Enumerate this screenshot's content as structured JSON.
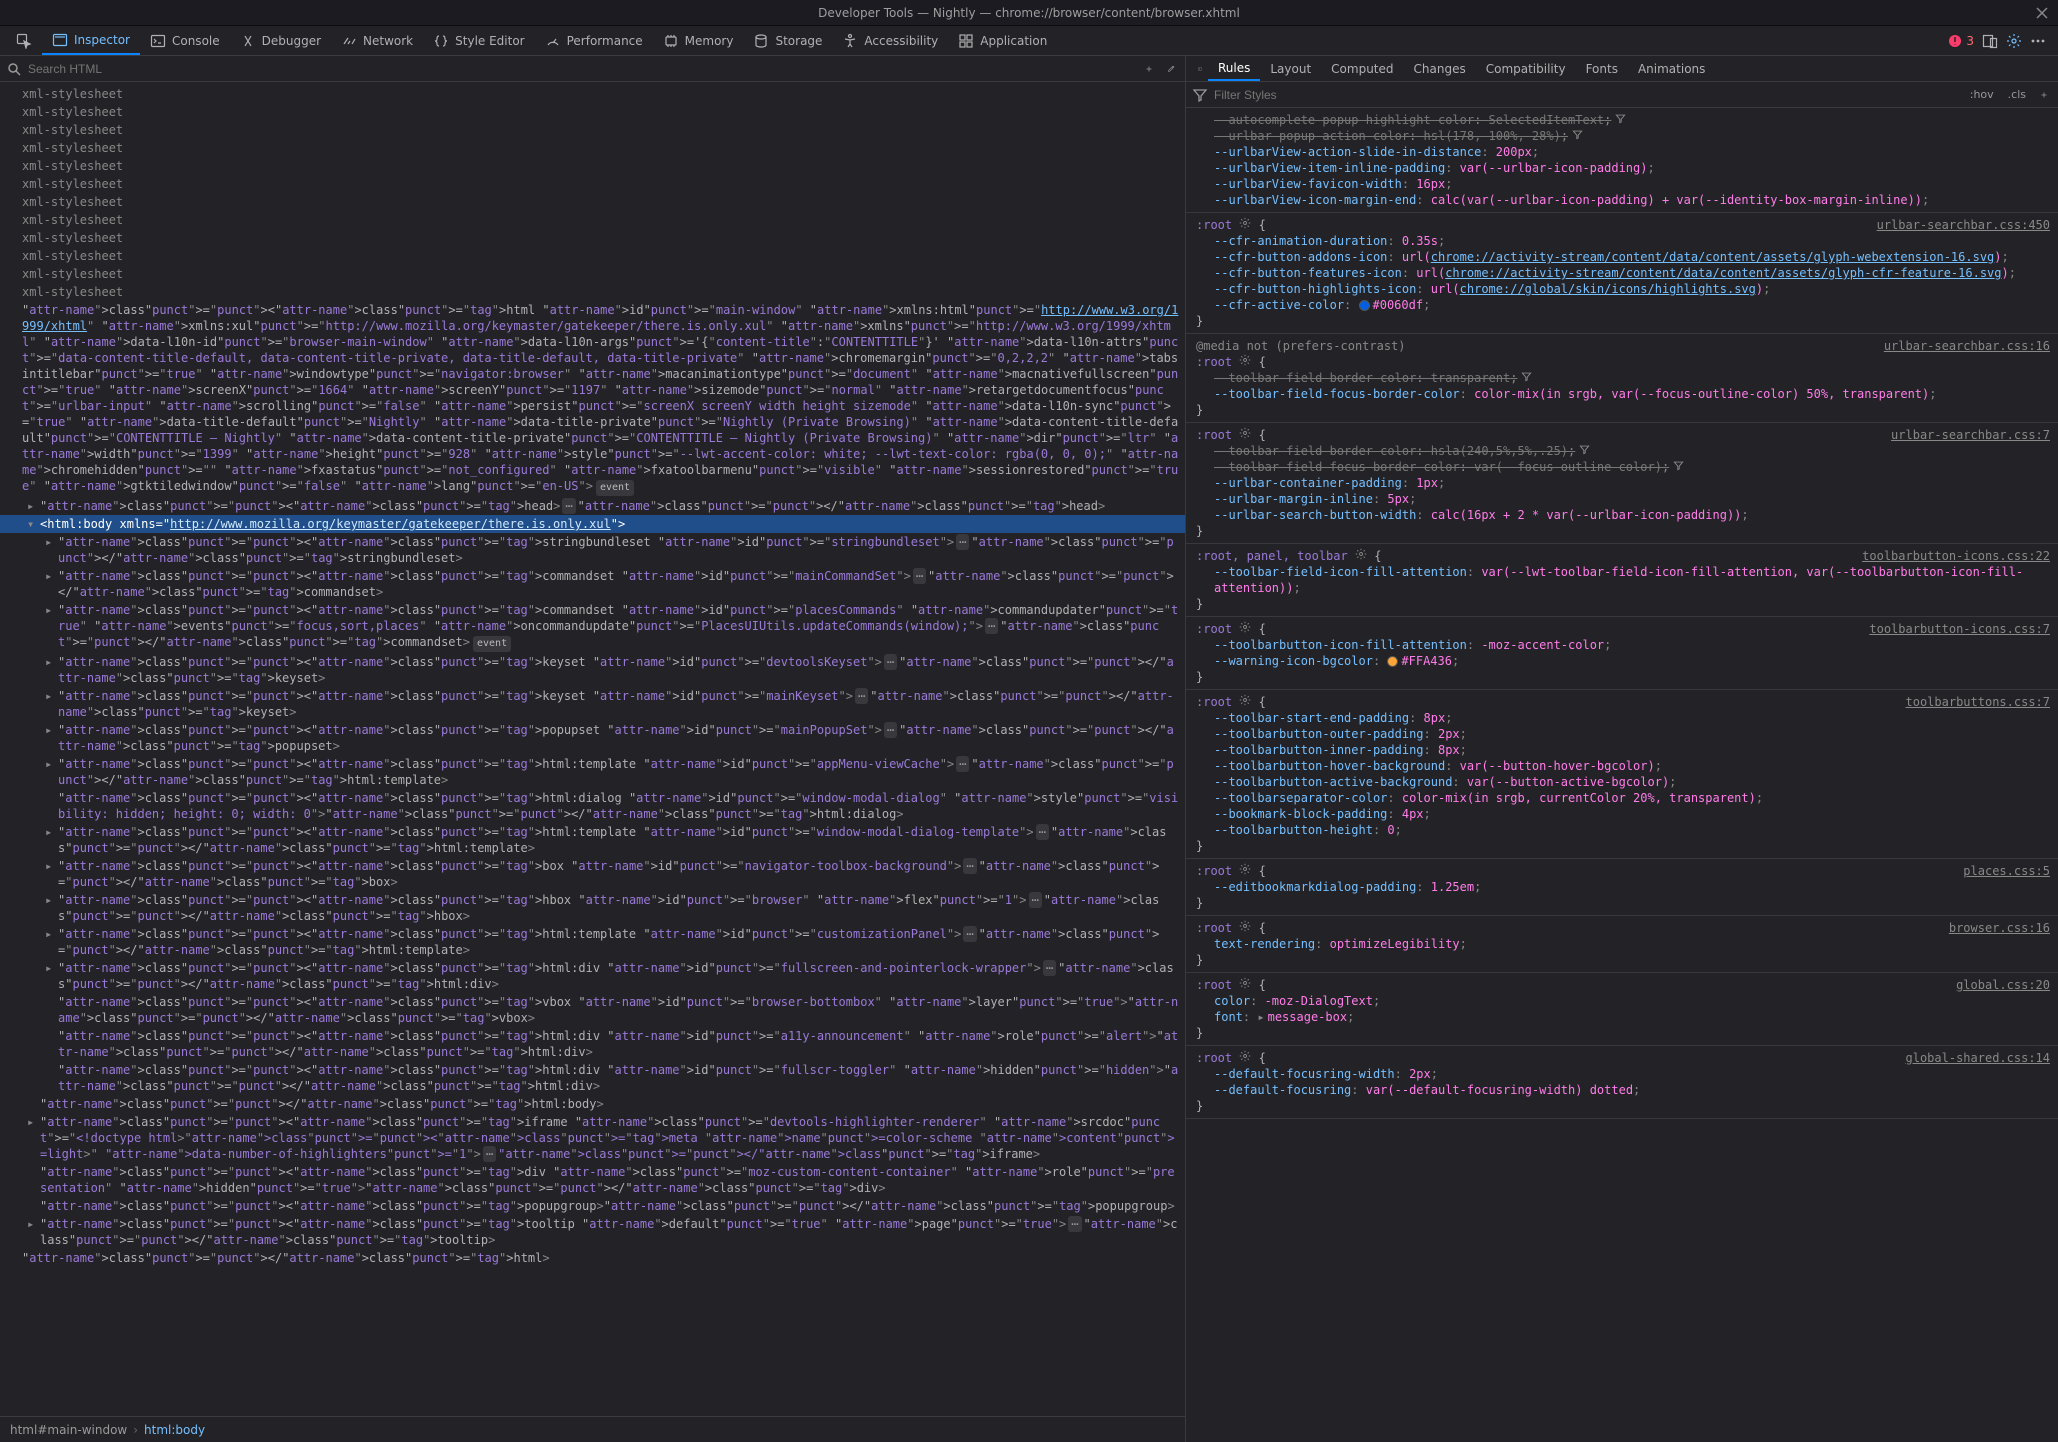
{
  "window": {
    "title": "Developer Tools — Nightly — chrome://browser/content/browser.xhtml"
  },
  "toolbar": {
    "inspector": "Inspector",
    "console": "Console",
    "debugger": "Debugger",
    "network": "Network",
    "styleeditor": "Style Editor",
    "performance": "Performance",
    "memory": "Memory",
    "storage": "Storage",
    "accessibility": "Accessibility",
    "application": "Application",
    "error_count": "3"
  },
  "searchbar": {
    "placeholder": "Search HTML"
  },
  "markup": {
    "xml_stylesheet": "xml-stylesheet",
    "html_open": "<html id=\"main-window\" xmlns:html=\"http://www.w3.org/1999/xhtml\" xmlns:xul=\"http://www.mozilla.org/keymaster/gatekeeper/there.is.only.xul\" xmlns=\"http://www.w3.org/1999/xhtml\" data-l10n-id=\"browser-main-window\" data-l10n-args='{\"content-title\":\"CONTENTTITLE\"}' data-l10n-attrs=\"data-content-title-default, data-content-title-private, data-title-default, data-title-private\" chromemargin=\"0,2,2,2\" tabsintitlebar=\"true\" windowtype=\"navigator:browser\" macanimationtype=\"document\" macnativefullscreen=\"true\" screenX=\"1664\" screenY=\"1197\" sizemode=\"normal\" retargetdocumentfocus=\"urlbar-input\" scrolling=\"false\" persist=\"screenX screenY width height sizemode\" data-l10n-sync=\"true\" data-title-default=\"Nightly\" data-title-private=\"Nightly (Private Browsing)\" data-content-title-default=\"CONTENTTITLE — Nightly\" data-content-title-private=\"CONTENTTITLE — Nightly (Private Browsing)\" dir=\"ltr\" width=\"1399\" height=\"928\" style=\"--lwt-accent-color: white; --lwt-text-color: rgba(0, 0, 0);\" chromehidden=\"\" fxastatus=\"not_configured\" fxatoolbarmenu=\"visible\" sessionrestored=\"true\" gtktiledwindow=\"false\" lang=\"en-US\">",
    "head": "<head>…</head>",
    "body_open": "<html:body xmlns=\"http://www.mozilla.org/keymaster/gatekeeper/there.is.only.xul\">",
    "child_stringbundleset": "<stringbundleset id=\"stringbundleset\">…</stringbundleset>",
    "child_commandset1": "<commandset id=\"mainCommandSet\">…</commandset>",
    "child_commandset2": "<commandset id=\"placesCommands\" commandupdater=\"true\" events=\"focus,sort,places\" oncommandupdate=\"PlacesUIUtils.updateCommands(window);\">…</commandset>",
    "child_keyset1": "<keyset id=\"devtoolsKeyset\">…</keyset>",
    "child_keyset2": "<keyset id=\"mainKeyset\">…</keyset>",
    "child_popupset": "<popupset id=\"mainPopupSet\">…</popupset>",
    "child_template1": "<html:template id=\"appMenu-viewCache\">…</html:template>",
    "child_dialog": "<html:dialog id=\"window-modal-dialog\" style=\"visibility: hidden; height: 0; width: 0\"></html:dialog>",
    "child_template2": "<html:template id=\"window-modal-dialog-template\">…</html:template>",
    "child_box": "<box id=\"navigator-toolbox-background\">…</box>",
    "child_hbox": "<hbox id=\"browser\" flex=\"1\">…</hbox>",
    "child_template3": "<html:template id=\"customizationPanel\">…</html:template>",
    "child_div1": "<html:div id=\"fullscreen-and-pointerlock-wrapper\">…</html:div>",
    "child_vbox": "<vbox id=\"browser-bottombox\" layer=\"true\"></vbox>",
    "child_div2": "<html:div id=\"a11y-announcement\" role=\"alert\"></html:div>",
    "child_div3": "<html:div id=\"fullscr-toggler\" hidden=\"hidden\"></html:div>",
    "body_close": "</html:body>",
    "iframe": "<iframe class=\"devtools-highlighter-renderer\" srcdoc=\"<!doctype html><meta name=color-scheme content=light>\" data-number-of-highlighters=\"1\">…</iframe>",
    "div_moz": "<div class=\"moz-custom-content-container\" role=\"presentation\" hidden=\"true\"></div>",
    "popupgroup": "<popupgroup></popupgroup>",
    "tooltip": "<tooltip default=\"true\" page=\"true\">…</tooltip>",
    "html_close": "</html>",
    "event_label": "event"
  },
  "breadcrumbs": {
    "c1": "html#main-window",
    "c2": "html:body"
  },
  "rules_tabs": {
    "rules": "Rules",
    "layout": "Layout",
    "computed": "Computed",
    "changes": "Changes",
    "compatibility": "Compatibility",
    "fonts": "Fonts",
    "animations": "Animations"
  },
  "filterbar": {
    "placeholder": "Filter Styles",
    "hov": ":hov",
    "cls": ".cls"
  },
  "rules": [
    {
      "source": "",
      "selector": "",
      "decls": [
        {
          "overridden": true,
          "prop": "--autocomplete-popup-highlight-color",
          "val": "SelectedItemText",
          "filter": true
        },
        {
          "overridden": true,
          "prop": "--urlbar-popup-action-color",
          "val": "hsl(178, 100%, 28%)",
          "filter": true
        },
        {
          "prop": "--urlbarView-action-slide-in-distance",
          "val": "200px"
        },
        {
          "prop": "--urlbarView-item-inline-padding",
          "val": "var(--urlbar-icon-padding)"
        },
        {
          "prop": "--urlbarView-favicon-width",
          "val": "16px"
        },
        {
          "prop": "--urlbarView-icon-margin-end",
          "val": "calc(var(--urlbar-icon-padding) + var(--identity-box-margin-inline))"
        }
      ]
    },
    {
      "source": "urlbar-searchbar.css:450",
      "selector": ":root",
      "decls": [
        {
          "prop": "--cfr-animation-duration",
          "val": "0.35s"
        },
        {
          "prop": "--cfr-button-addons-icon",
          "val_pre": "url(",
          "link": "chrome://activity-stream/content/data/content/assets/glyph-webextension-16.svg",
          "val_post": ")"
        },
        {
          "prop": "--cfr-button-features-icon",
          "val_pre": "url(",
          "link": "chrome://activity-stream/content/data/content/assets/glyph-cfr-feature-16.svg",
          "val_post": ")"
        },
        {
          "prop": "--cfr-button-highlights-icon",
          "val_pre": "url(",
          "link": "chrome://global/skin/icons/highlights.svg",
          "val_post": ")"
        },
        {
          "prop": "--cfr-active-color",
          "swatch": "#0060df",
          "val": "#0060df"
        }
      ]
    },
    {
      "source": "urlbar-searchbar.css:16",
      "media": "@media not (prefers-contrast)",
      "selector": ":root",
      "decls": [
        {
          "overridden": true,
          "prop": "--toolbar-field-border-color",
          "val": "transparent",
          "filter": true
        },
        {
          "prop": "--toolbar-field-focus-border-color",
          "val": "color-mix(in srgb, var(--focus-outline-color) 50%, transparent)"
        }
      ]
    },
    {
      "source": "urlbar-searchbar.css:7",
      "selector": ":root",
      "decls": [
        {
          "overridden": true,
          "prop": "--toolbar-field-border-color",
          "val": "hsla(240,5%,5%,.25)",
          "filter": true
        },
        {
          "overridden": true,
          "prop": "--toolbar-field-focus-border-color",
          "val": "var(--focus-outline-color)",
          "filter": true
        },
        {
          "prop": "--urlbar-container-padding",
          "val": "1px"
        },
        {
          "prop": "--urlbar-margin-inline",
          "val": "5px"
        },
        {
          "prop": "--urlbar-search-button-width",
          "val": "calc(16px + 2 * var(--urlbar-icon-padding))"
        }
      ]
    },
    {
      "source": "toolbarbutton-icons.css:22",
      "selector": ":root, panel, toolbar",
      "decls": [
        {
          "prop": "--toolbar-field-icon-fill-attention",
          "val": "var(--lwt-toolbar-field-icon-fill-attention, var(--toolbarbutton-icon-fill-attention))"
        }
      ]
    },
    {
      "source": "toolbarbutton-icons.css:7",
      "selector": ":root",
      "decls": [
        {
          "prop": "--toolbarbutton-icon-fill-attention",
          "val": "-moz-accent-color"
        },
        {
          "prop": "--warning-icon-bgcolor",
          "swatch": "#FFA436",
          "val": "#FFA436"
        }
      ]
    },
    {
      "source": "toolbarbuttons.css:7",
      "selector": ":root",
      "decls": [
        {
          "prop": "--toolbar-start-end-padding",
          "val": "8px"
        },
        {
          "prop": "--toolbarbutton-outer-padding",
          "val": "2px"
        },
        {
          "prop": "--toolbarbutton-inner-padding",
          "val": "8px"
        },
        {
          "prop": "--toolbarbutton-hover-background",
          "val": "var(--button-hover-bgcolor)"
        },
        {
          "prop": "--toolbarbutton-active-background",
          "val": "var(--button-active-bgcolor)"
        },
        {
          "prop": "--toolbarseparator-color",
          "val": "color-mix(in srgb, currentColor 20%, transparent)"
        },
        {
          "prop": "--bookmark-block-padding",
          "val": "4px"
        },
        {
          "prop": "--toolbarbutton-height",
          "val": "0"
        }
      ]
    },
    {
      "source": "places.css:5",
      "selector": ":root",
      "decls": [
        {
          "prop": "--editbookmarkdialog-padding",
          "val": "1.25em"
        }
      ]
    },
    {
      "source": "browser.css:16",
      "selector": ":root",
      "decls": [
        {
          "prop": "text-rendering",
          "val": "optimizeLegibility"
        }
      ]
    },
    {
      "source": "global.css:20",
      "selector": ":root",
      "decls": [
        {
          "prop": "color",
          "val": "-moz-DialogText"
        },
        {
          "prop": "font",
          "twisty": true,
          "val": "message-box"
        }
      ]
    },
    {
      "source": "global-shared.css:14",
      "selector": ":root",
      "decls": [
        {
          "prop": "--default-focusring-width",
          "val": "2px"
        },
        {
          "prop": "--default-focusring",
          "val": "var(--default-focusring-width) dotted"
        }
      ]
    }
  ]
}
